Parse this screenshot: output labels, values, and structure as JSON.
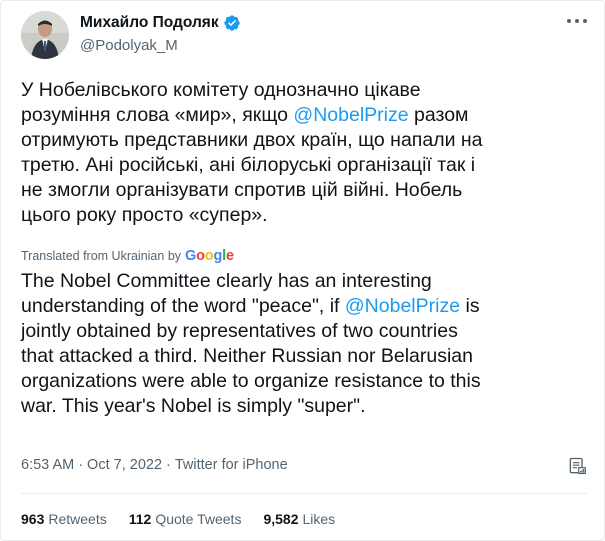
{
  "author": {
    "name": "Михайло Подоляк",
    "handle": "@Podolyak_M"
  },
  "tweet": {
    "original_lines": [
      [
        "У Нобелівського комітету однозначно цікаве"
      ],
      [
        "розуміння слова «мир», якщо ",
        "@NobelPrize",
        " разом"
      ],
      [
        "отримують представники двох країн, що напали на"
      ],
      [
        "третю. Ані російські, ані білоруські організації так і"
      ],
      [
        "не змогли організувати спротив цій війні. Нобель"
      ],
      [
        "цього року просто «супер»."
      ]
    ],
    "translated_label": "Translated from Ukrainian by",
    "translated_provider": "Google",
    "translation_lines": [
      [
        "The Nobel Committee clearly has an interesting"
      ],
      [
        "understanding of the word \"peace\", if ",
        "@NobelPrize",
        " is"
      ],
      [
        "jointly obtained by representatives of two countries"
      ],
      [
        "that attacked a third. Neither Russian nor Belarusian"
      ],
      [
        "organizations were able to organize resistance to this"
      ],
      [
        "war. This year's Nobel is simply \"super\"."
      ]
    ],
    "mention": "@NobelPrize"
  },
  "meta": {
    "time": "6:53 AM",
    "separator": "·",
    "date": "Oct 7, 2022",
    "source": "Twitter for iPhone"
  },
  "stats": {
    "retweets_count": "963",
    "retweets_label": "Retweets",
    "quotes_count": "112",
    "quotes_label": "Quote Tweets",
    "likes_count": "9,582",
    "likes_label": "Likes"
  },
  "colors": {
    "accent": "#1d9bf0",
    "secondary_text": "#536471",
    "primary_text": "#0f1419",
    "google_blue": "#4285f4",
    "google_red": "#ea4335",
    "google_yellow": "#fbbc05",
    "google_green": "#34a853"
  },
  "icons": [
    "verified-badge-icon",
    "more-options-icon",
    "tweet-info-icon"
  ]
}
